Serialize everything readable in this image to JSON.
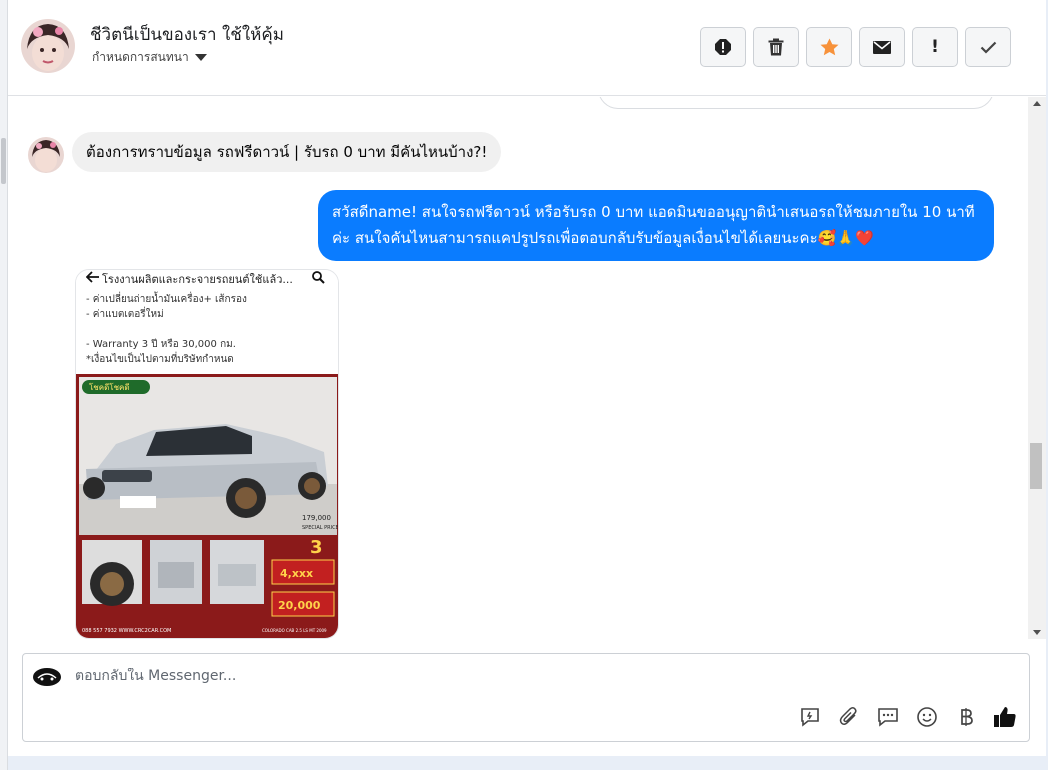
{
  "header": {
    "name": "ชีวิตนีเป็นของเรา ใช้ให้คุ้ม",
    "subtitle": "กำหนดการสนทนา",
    "actions": [
      {
        "icon": "report-icon"
      },
      {
        "icon": "trash-icon"
      },
      {
        "icon": "star-icon",
        "color": "#f7923b"
      },
      {
        "icon": "mail-icon"
      },
      {
        "icon": "exclamation-icon",
        "label": "!"
      },
      {
        "icon": "check-icon"
      }
    ]
  },
  "messages": {
    "incoming_text": "ต้องการทราบข้อมูล รถฟรีดาวน์ | รับรถ 0 บาท มีคันไหนบ้าง?!",
    "outgoing_text": "สวัสดีname! สนใจรถฟรีดาวน์ หรือรับรถ 0 บาท แอดมินขออนุญาตินำเสนอรถให้ชมภายใน 10 นาทีค่ะ สนใจคันไหนสามารถแคปรูปรถเพื่อตอบกลับรับข้อมูลเงื่อนไขได้เลยนะคะ🥰🙏❤️",
    "card": {
      "title": "โรงงานผลิตและกระจายรถยนต์ใช้แล้ว...",
      "lines": [
        "- ค่าเปลี่ยนถ่ายน้ำมันเครื่อง+ เส้กรอง",
        "- ค่าแบตเตอรี่ใหม่",
        "",
        "- Warranty 3 ปี หรือ 30,000 กม.",
        "*เงื่อนไขเป็นไปตามที่บริษัทกำหนด"
      ],
      "badge": "โชคดีโชคดี",
      "price_small": "179,000",
      "price_small_sub": "SPECIAL PRICE",
      "big_number": "3",
      "box1": "4,xxx",
      "box2": "20,000",
      "phone": "088 557 7932 WWW.CRC2CAR.COM",
      "model": "COLORADO CAB 2.5 LS MT 2009"
    }
  },
  "composer": {
    "placeholder": "ตอบกลับใน Messenger...",
    "tools": [
      "quick-reply-icon",
      "attach-icon",
      "saved-reply-icon",
      "emoji-icon",
      "baht-icon",
      "like-icon"
    ]
  },
  "colors": {
    "accent": "#0a7cff",
    "incoming_bg": "#f0f0f0"
  }
}
